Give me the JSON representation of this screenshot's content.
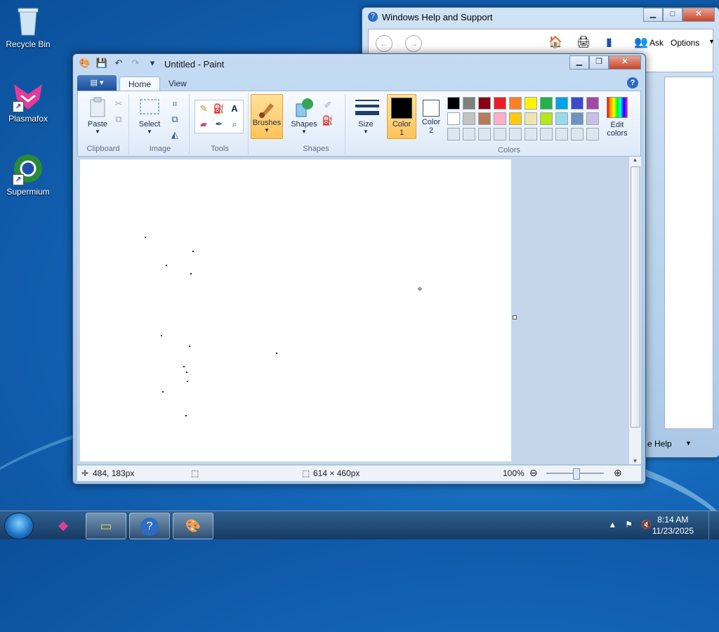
{
  "desktop": {
    "icons": [
      {
        "label": "Recycle Bin"
      },
      {
        "label": "Plasmafox"
      },
      {
        "label": "Supermium"
      }
    ]
  },
  "help_window": {
    "title": "Windows Help and Support",
    "toolbar": {
      "ask_label": "Ask",
      "options_label": "Options"
    },
    "footer_label": "e Help"
  },
  "paint": {
    "title": "Untitled - Paint",
    "tabs": [
      {
        "label": "Home"
      },
      {
        "label": "View"
      }
    ],
    "groups": {
      "clipboard": {
        "label": "Clipboard",
        "paste": "Paste"
      },
      "image": {
        "label": "Image",
        "select": "Select"
      },
      "tools": {
        "label": "Tools"
      },
      "brushes": {
        "label": "Brushes"
      },
      "shapes": {
        "label": "Shapes",
        "shapes_btn": "Shapes"
      },
      "size": {
        "label": "Size"
      },
      "colors": {
        "label": "Colors",
        "color1": "Color\n1",
        "color1_line1": "Color",
        "color1_line2": "1",
        "color2_line1": "Color",
        "color2_line2": "2",
        "edit_line1": "Edit",
        "edit_line2": "colors",
        "color1_value": "#000000",
        "color2_value": "#ffffff",
        "palette_row1": [
          "#000000",
          "#7f7f7f",
          "#880015",
          "#ed1c24",
          "#ff7f27",
          "#fff200",
          "#22b14c",
          "#00a2e8",
          "#3f48cc",
          "#a349a4"
        ],
        "palette_row2": [
          "#ffffff",
          "#c3c3c3",
          "#b97a57",
          "#ffaec9",
          "#ffc90e",
          "#efe4b0",
          "#b5e61d",
          "#99d9ea",
          "#7092be",
          "#c8bfe7"
        ]
      }
    },
    "status": {
      "cursor_pos": "484, 183px",
      "canvas_size": "614 × 460px",
      "zoom": "100%"
    }
  },
  "taskbar": {
    "time": "8:14 AM",
    "date": "11/23/2025"
  }
}
